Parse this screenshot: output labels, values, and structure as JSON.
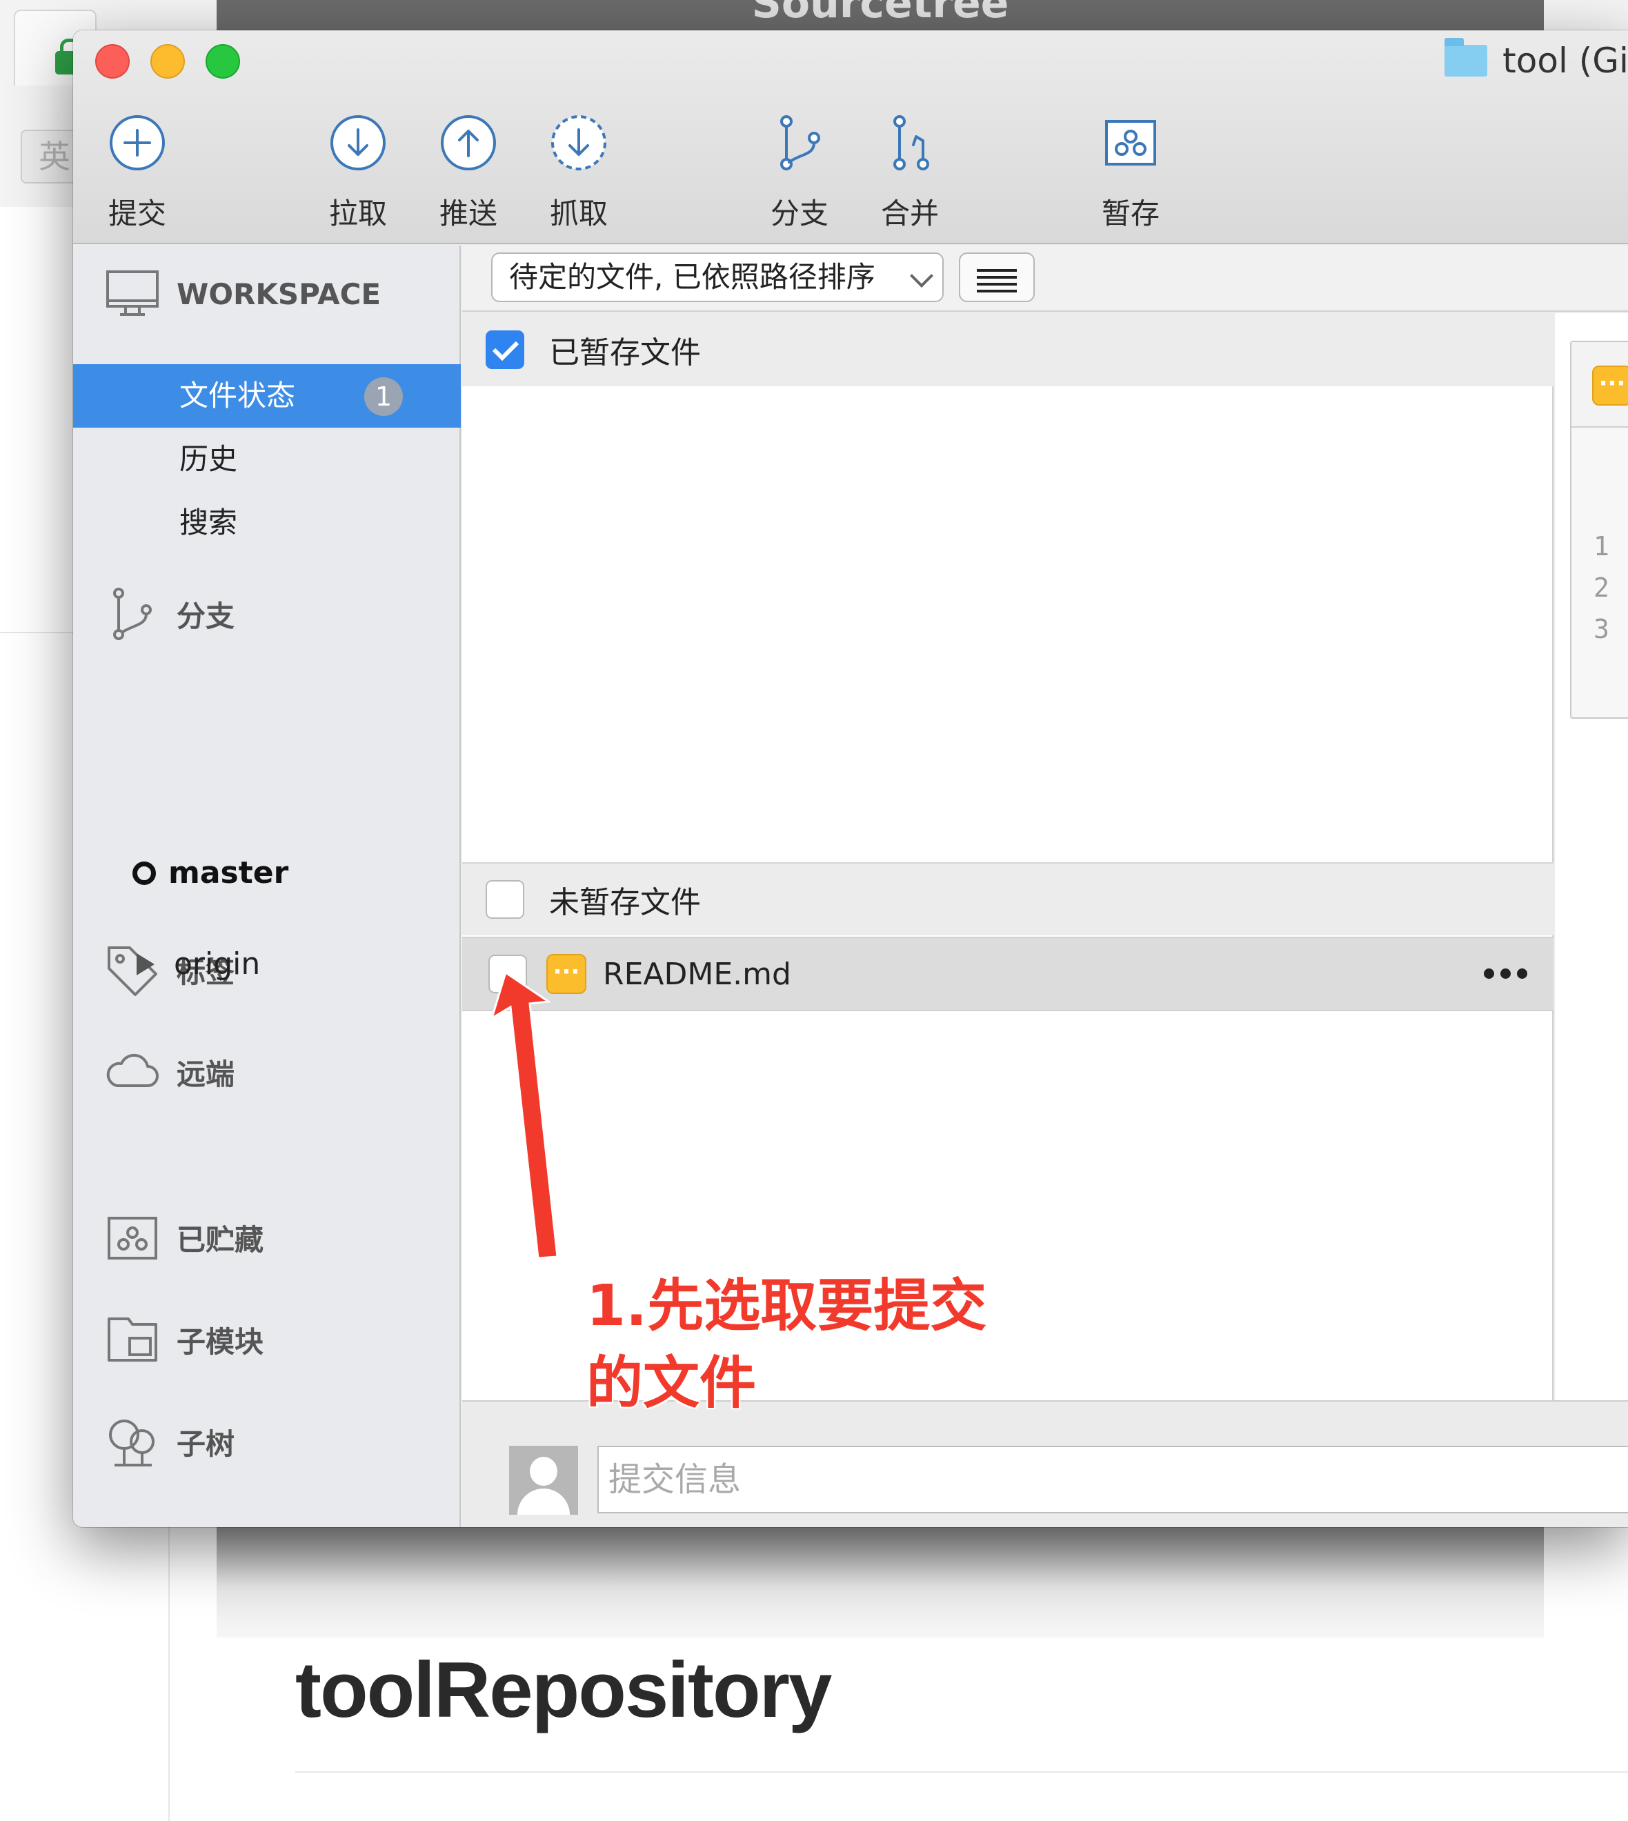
{
  "background": {
    "ime_label": "英",
    "dark_window_title": "Sourcetree",
    "repo_heading": "toolRepository"
  },
  "window": {
    "title": "tool (Git)"
  },
  "toolbar": {
    "commit": "提交",
    "pull": "拉取",
    "push": "推送",
    "fetch": "抓取",
    "branch": "分支",
    "merge": "合并",
    "stash": "暂存"
  },
  "sidebar": {
    "workspace": "WORKSPACE",
    "file_status": "文件状态",
    "file_status_count": "1",
    "history": "历史",
    "search": "搜索",
    "branches": "分支",
    "current_branch": "master",
    "tags": "标签",
    "remotes": "远端",
    "remote_origin": "origin",
    "stashes": "已贮藏",
    "submodules": "子模块",
    "subtrees": "子树"
  },
  "filter": {
    "selected": "待定的文件, 已依照路径排序"
  },
  "staged": {
    "header": "已暂存文件",
    "checked": true
  },
  "unstaged": {
    "header": "未暂存文件",
    "checked": false,
    "files": [
      {
        "name": "README.md",
        "status_badge": "···",
        "checked": false
      }
    ]
  },
  "diff": {
    "line_numbers": [
      "1",
      "2",
      "3"
    ]
  },
  "commit": {
    "placeholder": "提交信息",
    "value": ""
  },
  "annotation": {
    "line1": "1.先选取要提交",
    "line2": "的文件"
  },
  "colors": {
    "accent_selection": "#3d8de7",
    "checkbox_blue": "#2f84f0",
    "modified_badge": "#fbbd2c",
    "annotation_red": "#f23a2c",
    "toolbar_icon_blue": "#3c78b8"
  }
}
